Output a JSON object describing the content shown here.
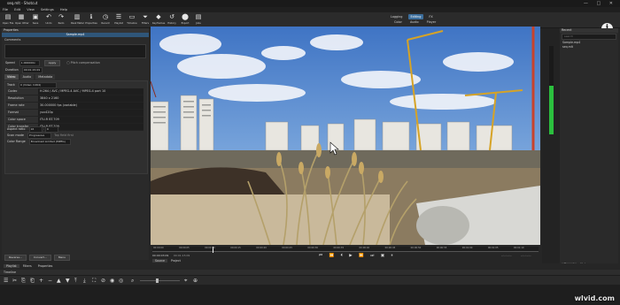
{
  "app": {
    "window_title": "seq.mlt - Shotcut",
    "window_buttons": [
      "—",
      "□",
      "✕"
    ]
  },
  "menu": [
    "File",
    "Edit",
    "View",
    "Settings",
    "Help"
  ],
  "toolbar": {
    "buttons": [
      {
        "icon": "open-folder-icon",
        "glyph": "▤",
        "label": "Open File"
      },
      {
        "icon": "open-other-icon",
        "glyph": "▦",
        "label": "Open Other"
      },
      {
        "icon": "save-icon",
        "glyph": "▣",
        "label": "Save"
      },
      {
        "icon": "undo-icon",
        "glyph": "↶",
        "label": "Undo"
      },
      {
        "icon": "redo-icon",
        "glyph": "↷",
        "label": "Redo"
      },
      {
        "icon": "peak-meter-icon",
        "glyph": "▥",
        "label": "Peak Meter"
      },
      {
        "icon": "properties-icon",
        "glyph": "ℹ",
        "label": "Properties"
      },
      {
        "icon": "recent-icon",
        "glyph": "◷",
        "label": "Recent"
      },
      {
        "icon": "playlist-icon",
        "glyph": "☰",
        "label": "Playlist"
      },
      {
        "icon": "timeline-icon",
        "glyph": "▭",
        "label": "Timeline"
      },
      {
        "icon": "filters-icon",
        "glyph": "⏷",
        "label": "Filters"
      },
      {
        "icon": "keyframes-icon",
        "glyph": "◆",
        "label": "Keyframes"
      },
      {
        "icon": "history-icon",
        "glyph": "↺",
        "label": "History"
      },
      {
        "icon": "export-icon",
        "glyph": "⬤",
        "label": "Export"
      },
      {
        "icon": "jobs-icon",
        "glyph": "▤",
        "label": "Jobs"
      }
    ],
    "layouts_row1": [
      "Logging",
      "Editing",
      "FX"
    ],
    "layouts_row2": [
      "Color",
      "Audio",
      "Player"
    ],
    "active_layout": "Editing"
  },
  "info_button": "i",
  "properties": {
    "header": "Properties",
    "clip_title": "Sample.mp4",
    "comments_label": "Comments",
    "speed_label": "Speed",
    "speed_value": "1.000000x",
    "apply_button": "Apply",
    "pitch_label": "Pitch compensation",
    "duration_label": "Duration",
    "duration_value": "00:01:15:09",
    "tabs": [
      "Video",
      "Audio",
      "Metadata"
    ],
    "track_label": "Track",
    "track_value": "0 (Video: h264)",
    "rows": [
      {
        "k": "Codec",
        "v": "H.264 / AVC / MPEG-4 AVC / MPEG-4 part 10"
      },
      {
        "k": "Resolution",
        "v": "3840 x 2160"
      },
      {
        "k": "Frame rate",
        "v": "30.000000 fps (variable)"
      },
      {
        "k": "Format",
        "v": "yuv420p"
      },
      {
        "k": "Color space",
        "v": "ITU-R BT.709"
      },
      {
        "k": "Color transfer",
        "v": "ITU-R BT.709"
      }
    ],
    "aspect_label": "Aspect ratio",
    "aspect_a": "16",
    "aspect_b": "9",
    "scan_label": "Scan mode",
    "scan_value": "Progressive",
    "field_order": "Top field first",
    "range_label": "Color Range",
    "range_value": "Broadcast Limited (MPEG)",
    "bottom_buttons": [
      "Reverse...",
      "Convert...",
      "Menu"
    ]
  },
  "player": {
    "timecode_left": "00:00:03:09",
    "timecode_right": "00:01:15:09",
    "in_point": "--:--:--:--",
    "out_point": "--:--:--:--",
    "transport": [
      "⏮",
      "⏪",
      "⏴",
      "▶",
      "⏩",
      "⏭",
      "▣",
      "⏸"
    ],
    "tick_labels": [
      "00:00:00",
      "00:00:05",
      "00:00:10",
      "00:00:15",
      "00:00:20",
      "00:00:25",
      "00:00:30",
      "00:00:35",
      "00:00:40",
      "00:00:45",
      "00:00:50",
      "00:00:55",
      "00:01:00",
      "00:01:05",
      "00:01:10"
    ],
    "tabs": [
      "Source",
      "Project"
    ]
  },
  "right": {
    "header": "Recent",
    "search_placeholder": "search",
    "items": [
      "Sample.mp4",
      "seq.mlt"
    ],
    "tabs": [
      "Recent",
      "History"
    ],
    "meter_level": 0.55
  },
  "bottom_tabs": [
    "Playlist",
    "Filters",
    "Properties"
  ],
  "timeline": {
    "header": "Timeline",
    "tools": [
      "☰",
      "✂",
      "⎘",
      "⎗",
      "+",
      "−",
      "▲",
      "▼",
      "⤒",
      "⤓",
      "⛶",
      "⊘",
      "◉",
      "◎",
      "⌕",
      "⌖",
      "⊕"
    ]
  },
  "watermark": "wlvid.com",
  "colors": {
    "accent": "#3c6e9c",
    "sky": "#5d8fd0",
    "meter": "#2bbf3e"
  }
}
